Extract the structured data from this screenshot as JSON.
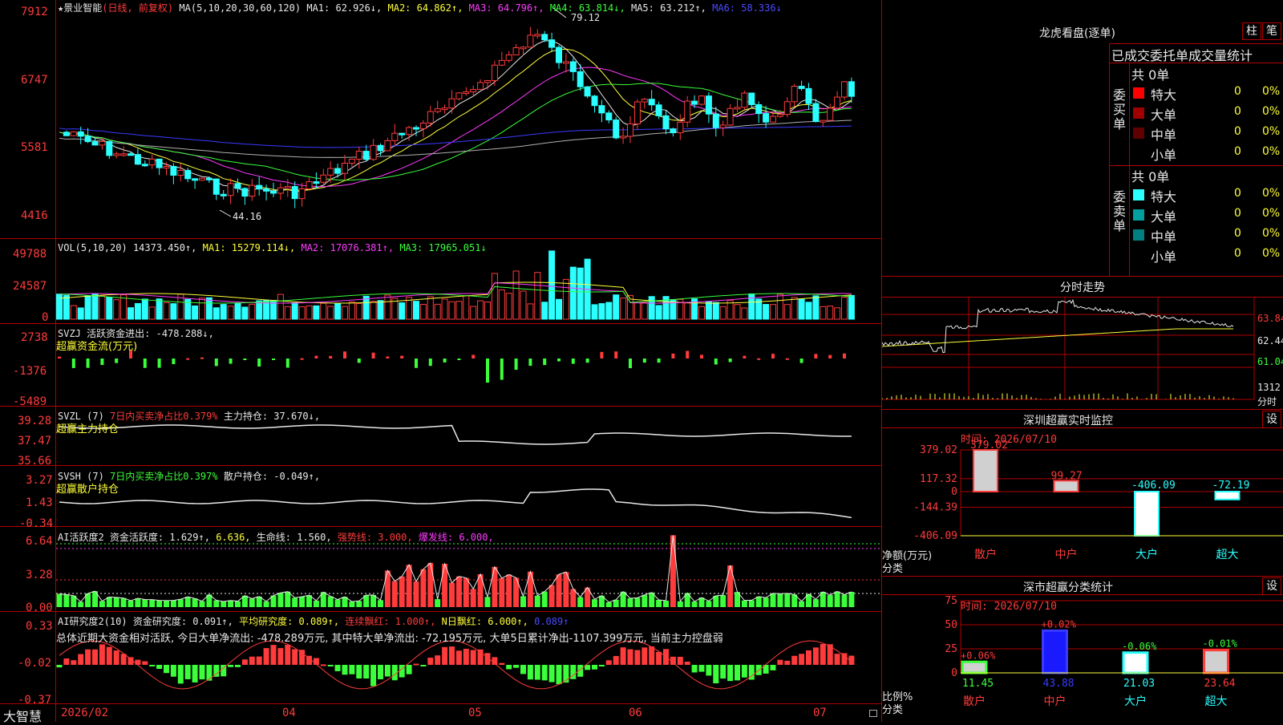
{
  "stock": {
    "star": "★",
    "name": "景业智能",
    "mode": "(日线, 前复权)"
  },
  "main_panel": {
    "ma_label": "MA(5,10,20,30,60,120)",
    "ma1": "MA1: 62.926↓,",
    "ma2": "MA2: 64.862↑,",
    "ma3": "MA3: 64.796↑,",
    "ma4": "MA4: 63.814↓,",
    "ma5": "MA5: 63.212↑,",
    "ma6": "MA6: 58.336↓",
    "y_ticks": [
      "7912",
      "6747",
      "5581",
      "4416"
    ],
    "high_label": "79.12",
    "low_label": "44.16"
  },
  "vol_panel": {
    "label": "VOL(5,10,20)",
    "value": "14373.450↑,",
    "ma1": "MA1: 15279.114↓,",
    "ma2": "MA2: 17076.381↑,",
    "ma3": "MA3: 17965.051↓",
    "y_ticks": [
      "49788",
      "24587",
      "0"
    ]
  },
  "svzj_panel": {
    "label": "SVZJ",
    "active": "活跃资金进出: -478.288↓,",
    "sub": "超赢资金流(万元)",
    "y_ticks": [
      "2738",
      "-1376",
      "-5489"
    ]
  },
  "svzl_panel": {
    "label": "SVZL (7)",
    "ratio": "7日内买卖净占比0.379%",
    "hold": "主力持仓: 37.670↓,",
    "sub": "超赢主力持仓",
    "y_ticks": [
      "39.28",
      "37.47",
      "35.66"
    ]
  },
  "svsh_panel": {
    "label": "SVSH (7)",
    "ratio": "7日内买卖净占比0.397%",
    "hold": "散户持仓: -0.049↑,",
    "sub": "超赢散户持仓",
    "y_ticks": [
      "3.27",
      "1.43",
      "-0.34"
    ]
  },
  "ai_active": {
    "label": "AI活跃度2",
    "active": "资金活跃度: 1.629↑,",
    "v2": "6.636,",
    "life": "生命线: 1.560,",
    "strong": "强势线: 3.000,",
    "burst": "爆发线: 6.000,",
    "y_ticks": [
      "6.64",
      "3.28",
      "0.00"
    ]
  },
  "ai_research": {
    "label": "AI研究度2(10)",
    "research": "资金研究度: 0.091↑,",
    "avg": "平均研究度: 0.089↑,",
    "cont": "连续飘红: 1.000↑,",
    "n": "N日飘红: 6.000↑,",
    "n2": "0.089↑",
    "summary": "总体近期大资金相对活跃, 今日大单净流出: -478.289万元, 其中特大单净流出: -72.195万元, 大单5日累计净出-1107.399万元, 当前主力控盘弱",
    "y_ticks": [
      "0.33",
      "-0.02",
      "-0.37"
    ]
  },
  "x_axis": [
    "2026/02",
    "04",
    "05",
    "06",
    "07"
  ],
  "brand": "大智慧",
  "dragon": {
    "title": "龙虎看盘(逐单)",
    "btn_bar": "柱",
    "btn_pen": "笔",
    "tabs": [
      "已成交",
      "委托单",
      "成交量统计"
    ],
    "buy": {
      "label": "委买单",
      "total": "共 0单",
      "rows": [
        {
          "name": "特大",
          "color": "#ff0000",
          "v": "0",
          "p": "0%"
        },
        {
          "name": "大单",
          "color": "#a00000",
          "v": "0",
          "p": "0%"
        },
        {
          "name": "中单",
          "color": "#600000",
          "v": "0",
          "p": "0%"
        },
        {
          "name": "小单",
          "color": "#000000",
          "v": "0",
          "p": "0%"
        }
      ]
    },
    "sell": {
      "label": "委卖单",
      "total": "共 0单",
      "rows": [
        {
          "name": "特大",
          "color": "#2bffff",
          "v": "0",
          "p": "0%"
        },
        {
          "name": "大单",
          "color": "#00a0a0",
          "v": "0",
          "p": "0%"
        },
        {
          "name": "中单",
          "color": "#008080",
          "v": "0",
          "p": "0%"
        },
        {
          "name": "小单",
          "color": "#000000",
          "v": "0",
          "p": "0%"
        }
      ]
    }
  },
  "intraday": {
    "title": "分时走势",
    "y_ticks": [
      "63.84",
      "62.44",
      "61.04"
    ],
    "vol_tick": "1312",
    "vol_unit": "分时"
  },
  "monitor": {
    "title": "深圳超赢实时监控",
    "btn": "设",
    "time": "时间: 2026/07/10",
    "y_ticks": [
      "379.02",
      "117.32",
      "0",
      "-144.39",
      "-406.09"
    ],
    "ylabel": "净额(万元)",
    "xlabel": "分类",
    "categories": [
      "散户",
      "中户",
      "大户",
      "超大"
    ],
    "values": [
      379.02,
      99.27,
      -406.09,
      -72.19
    ],
    "labels": [
      "379.02",
      "99.27",
      "-406.09",
      "-72.19"
    ]
  },
  "classify": {
    "title": "深市超赢分类统计",
    "btn": "设",
    "time": "时间: 2026/07/10",
    "y_ticks": [
      "75",
      "50",
      "25",
      "0"
    ],
    "ylabel": "比例%",
    "xlabel": "分类",
    "categories": [
      "散户",
      "中户",
      "大户",
      "超大"
    ],
    "values": [
      11.45,
      43.88,
      21.03,
      23.64
    ],
    "deltas": [
      "+0.06%",
      "+0.02%",
      "-0.06%",
      "-0.01%"
    ],
    "value_labels": [
      "11.45",
      "43.88",
      "21.03",
      "23.64"
    ]
  }
}
